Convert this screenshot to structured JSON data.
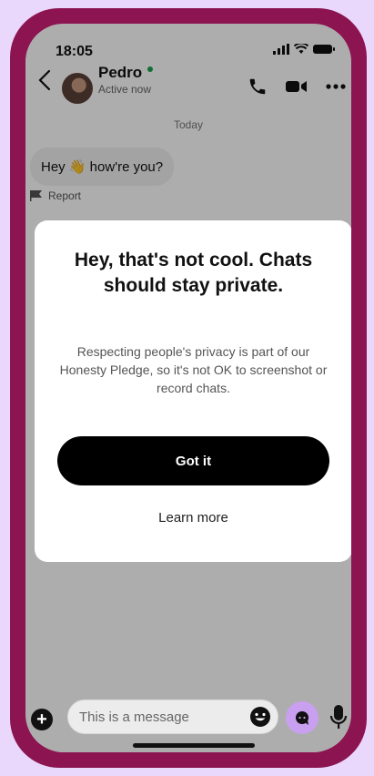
{
  "status_bar": {
    "time": "18:05"
  },
  "header": {
    "contact_name": "Pedro",
    "status": "Active now"
  },
  "chat": {
    "date_divider": "Today",
    "message": "Hey 👋 how're you?",
    "report_label": "Report"
  },
  "modal": {
    "title": "Hey, that's not cool. Chats should stay private.",
    "body": "Respecting people's privacy is part of our Honesty Pledge, so it's not OK to screenshot or record chats.",
    "primary_button": "Got it",
    "secondary_link": "Learn more"
  },
  "composer": {
    "placeholder": "This is a message"
  },
  "colors": {
    "background": "#e9d8fb",
    "phone_frame": "#8c1450",
    "online_dot": "#1aa24b",
    "assistant_button": "#c9a0ef"
  },
  "icons": [
    "signal-icon",
    "wifi-icon",
    "battery-icon",
    "back-icon",
    "phone-icon",
    "video-icon",
    "more-icon",
    "flag-icon",
    "plus-icon",
    "emoji-icon",
    "assistant-icon",
    "mic-icon"
  ]
}
